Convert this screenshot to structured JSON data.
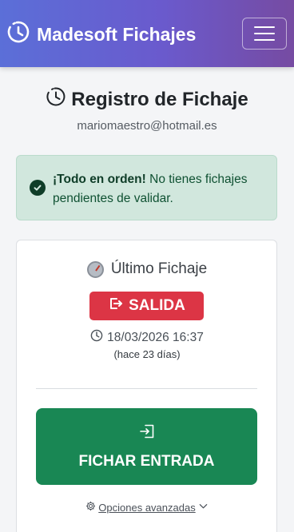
{
  "navbar": {
    "brand": "Madesoft Fichajes",
    "brand_icon": "clock-history-icon",
    "toggle_icon": "hamburger-menu-icon"
  },
  "page": {
    "title": "Registro de Fichaje",
    "title_icon": "clock-history-icon",
    "email": "mariomaestro@hotmail.es"
  },
  "alert": {
    "icon": "check-circle-icon",
    "strong": "¡Todo en orden!",
    "text": " No tienes fichajes pendientes de validar."
  },
  "last_entry": {
    "title": "Último Fichaje",
    "title_icon": "stopwatch-icon",
    "type_label": "SALIDA",
    "type_icon": "box-arrow-right-icon",
    "datetime": "18/03/2026 16:37",
    "datetime_icon": "clock-icon",
    "ago": "(hace 23 días)"
  },
  "action": {
    "label": "FICHAR ENTRADA",
    "icon": "box-arrow-in-right-icon"
  },
  "advanced": {
    "label": " Opciones avanzadas",
    "icon": "gear-icon",
    "chevron": "chevron-down-icon"
  },
  "colors": {
    "navbar_start": "#5b6fd8",
    "navbar_end": "#764ba2",
    "success_bg": "#d1e7dd",
    "danger": "#dc3545",
    "success": "#198754"
  }
}
